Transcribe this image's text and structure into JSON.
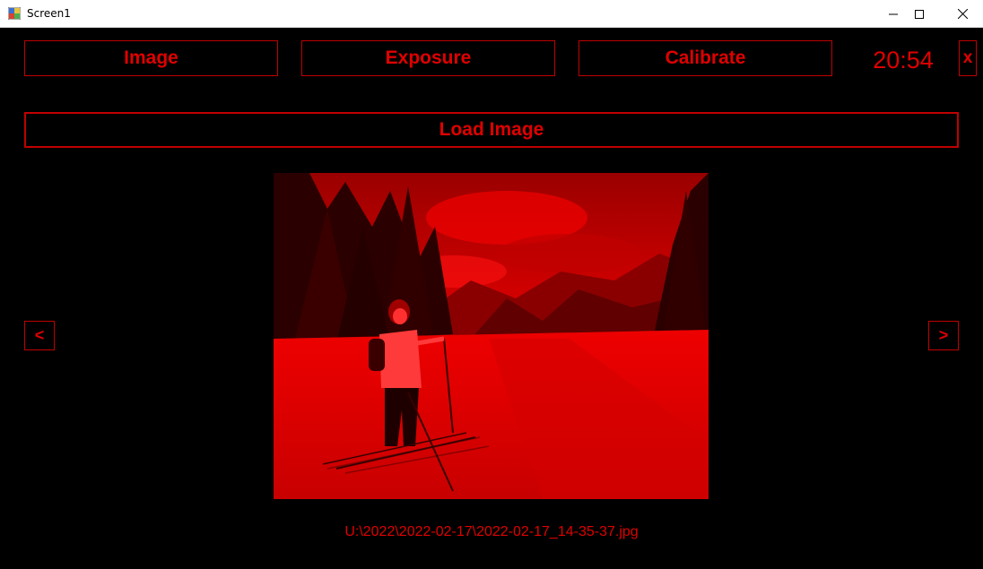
{
  "window": {
    "title": "Screen1",
    "icon": "app-icon",
    "controls": [
      "minimize-icon",
      "maximize-icon",
      "close-icon"
    ]
  },
  "toolbar": {
    "image_label": "Image",
    "exposure_label": "Exposure",
    "calibrate_label": "Calibrate",
    "clock": "20:54",
    "close_label": "x"
  },
  "main": {
    "load_image_label": "Load Image",
    "prev_label": "<",
    "next_label": ">",
    "file_path": "U:\\2022\\2022-02-17\\2022-02-17_14-35-37.jpg",
    "photo_description": "red-tinted photo of a cross-country skier on a snowy trail"
  },
  "colors": {
    "accent": "#e00000",
    "border": "#c00000",
    "background": "#000000"
  }
}
